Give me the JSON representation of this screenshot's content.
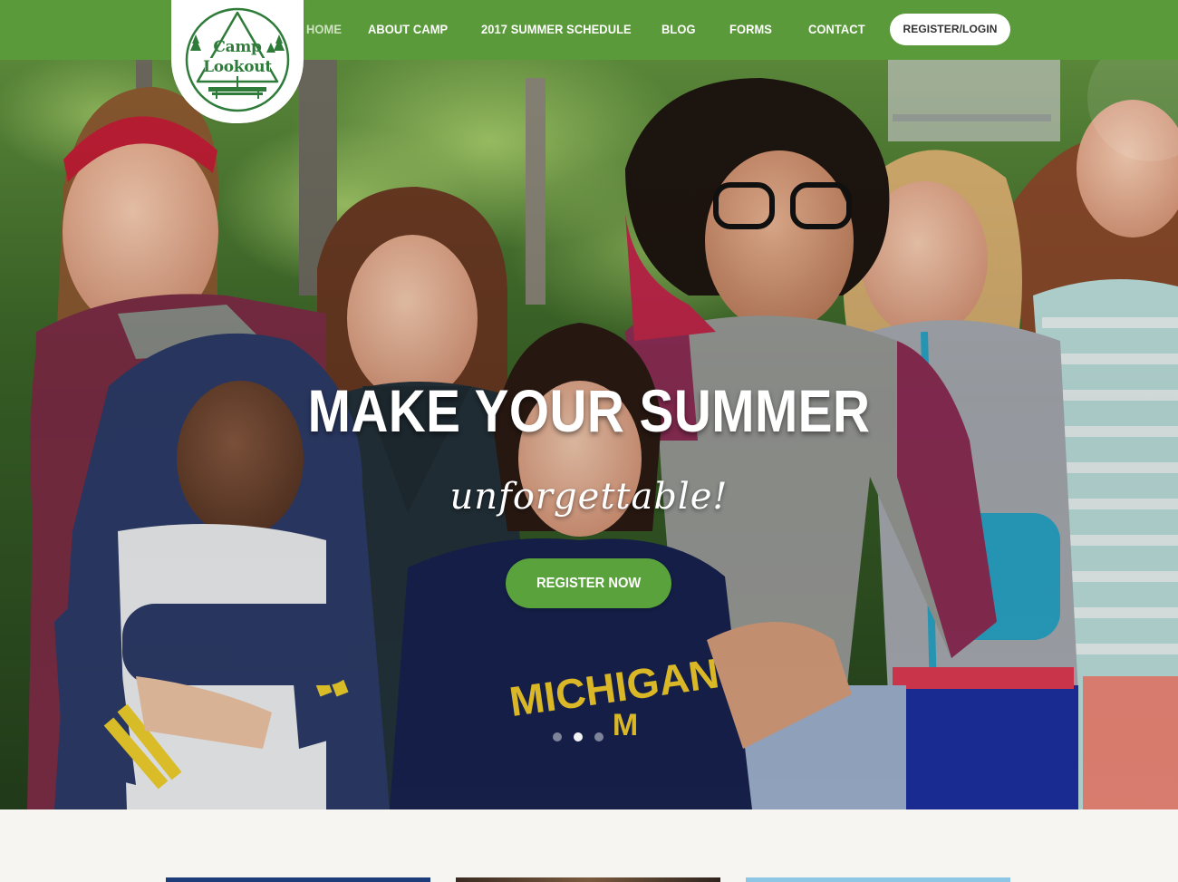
{
  "nav": {
    "items": [
      {
        "label": "HOME"
      },
      {
        "label": "ABOUT CAMP"
      },
      {
        "label": "2017 SUMMER SCHEDULE"
      },
      {
        "label": "BLOG"
      },
      {
        "label": "FORMS"
      },
      {
        "label": "CONTACT"
      }
    ],
    "register_login": "REGISTER/LOGIN"
  },
  "logo": {
    "line1": "Camp",
    "line2": "Lookout"
  },
  "hero": {
    "title": "MAKE YOUR SUMMER",
    "subtitle": "unforgettable!",
    "cta": "REGISTER NOW",
    "slides_total": 3,
    "active_slide": 2
  },
  "colors": {
    "nav_green": "#5a9a3a",
    "cta_green": "#5aa23c",
    "logo_green": "#2f7c3a",
    "page_bg": "#f7f5f1"
  },
  "icons": {
    "logo": "camp-lookout-triangle-logo",
    "dots": "slider-dot"
  }
}
